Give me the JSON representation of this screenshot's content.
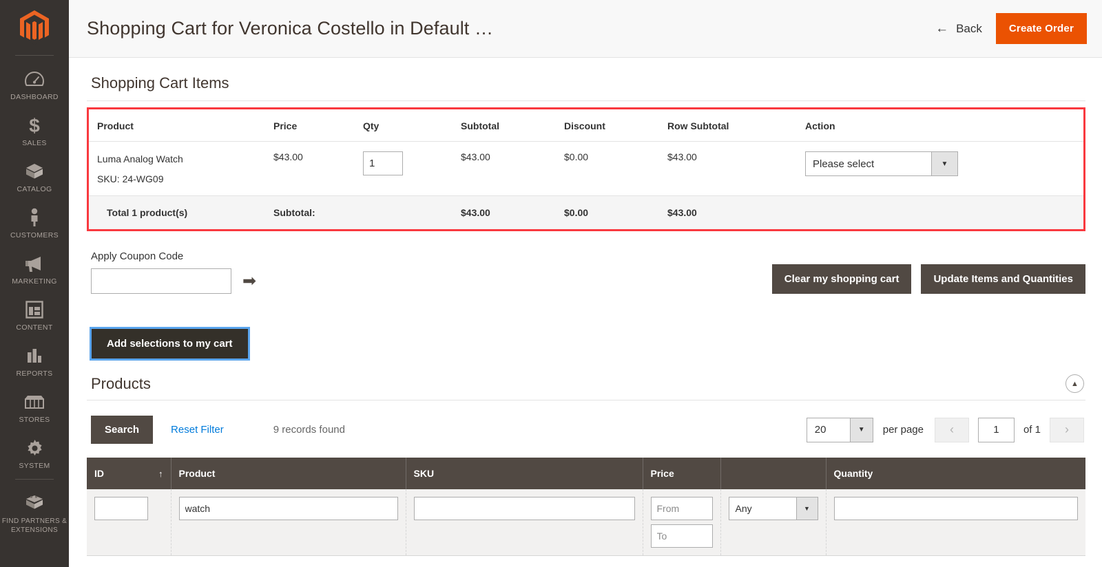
{
  "sidebar": {
    "logo_alt": "magento-logo",
    "items": [
      {
        "label": "DASHBOARD",
        "icon": "dashboard-icon"
      },
      {
        "label": "SALES",
        "icon": "dollar-icon"
      },
      {
        "label": "CATALOG",
        "icon": "box-icon"
      },
      {
        "label": "CUSTOMERS",
        "icon": "person-icon"
      },
      {
        "label": "MARKETING",
        "icon": "megaphone-icon"
      },
      {
        "label": "CONTENT",
        "icon": "layout-icon"
      },
      {
        "label": "REPORTS",
        "icon": "bar-chart-icon"
      },
      {
        "label": "STORES",
        "icon": "storefront-icon"
      },
      {
        "label": "SYSTEM",
        "icon": "gear-icon"
      },
      {
        "label": "FIND PARTNERS & EXTENSIONS",
        "icon": "extension-box-icon"
      }
    ]
  },
  "header": {
    "title": "Shopping Cart for Veronica Costello in Default …",
    "back_label": "Back",
    "back_icon": "arrow-left-icon",
    "create_order_label": "Create Order",
    "accent_color": "#eb5202"
  },
  "cart": {
    "section_title": "Shopping Cart Items",
    "highlight_color": "#f9393f",
    "columns": [
      "Product",
      "Price",
      "Qty",
      "Subtotal",
      "Discount",
      "Row Subtotal",
      "Action"
    ],
    "row": {
      "product_name": "Luma Analog Watch",
      "sku": "SKU: 24-WG09",
      "price": "$43.00",
      "qty": "1",
      "subtotal": "$43.00",
      "discount": "$0.00",
      "row_subtotal": "$43.00",
      "action_select": "Please select"
    },
    "totals": {
      "label": "Total 1 product(s)",
      "subtotal_label": "Subtotal:",
      "subtotal": "$43.00",
      "discount": "$0.00",
      "row_subtotal": "$43.00"
    }
  },
  "coupon": {
    "label": "Apply Coupon Code",
    "value": "",
    "placeholder": "",
    "apply_icon": "arrow-right-icon",
    "clear_cart_label": "Clear my shopping cart",
    "update_items_label": "Update Items and Quantities"
  },
  "add_selections": {
    "label": "Add selections to my cart",
    "focus_ring_color": "#5aa5ee"
  },
  "products": {
    "title": "Products",
    "collapse_icon": "chevron-up-icon",
    "toolbar": {
      "search_label": "Search",
      "reset_filter_label": "Reset Filter",
      "records_found": "9 records found",
      "per_page_value": "20",
      "per_page_label": "per page",
      "prev_icon": "chevron-left-icon",
      "next_icon": "chevron-right-icon",
      "page_value": "1",
      "of_label": "of 1"
    },
    "grid": {
      "columns": [
        {
          "label": "ID",
          "sort": "asc",
          "sort_icon": "arrow-up-icon"
        },
        {
          "label": "Product",
          "sort": ""
        },
        {
          "label": "SKU",
          "sort": ""
        },
        {
          "label": "Price",
          "sort": ""
        },
        {
          "label": "",
          "sort": ""
        },
        {
          "label": "Quantity",
          "sort": ""
        }
      ],
      "filters": {
        "id": "",
        "product": "watch",
        "sku": "",
        "price_from_placeholder": "From",
        "price_to_placeholder": "To",
        "price_from": "",
        "price_to": "",
        "type_value": "Any",
        "quantity": ""
      }
    }
  }
}
